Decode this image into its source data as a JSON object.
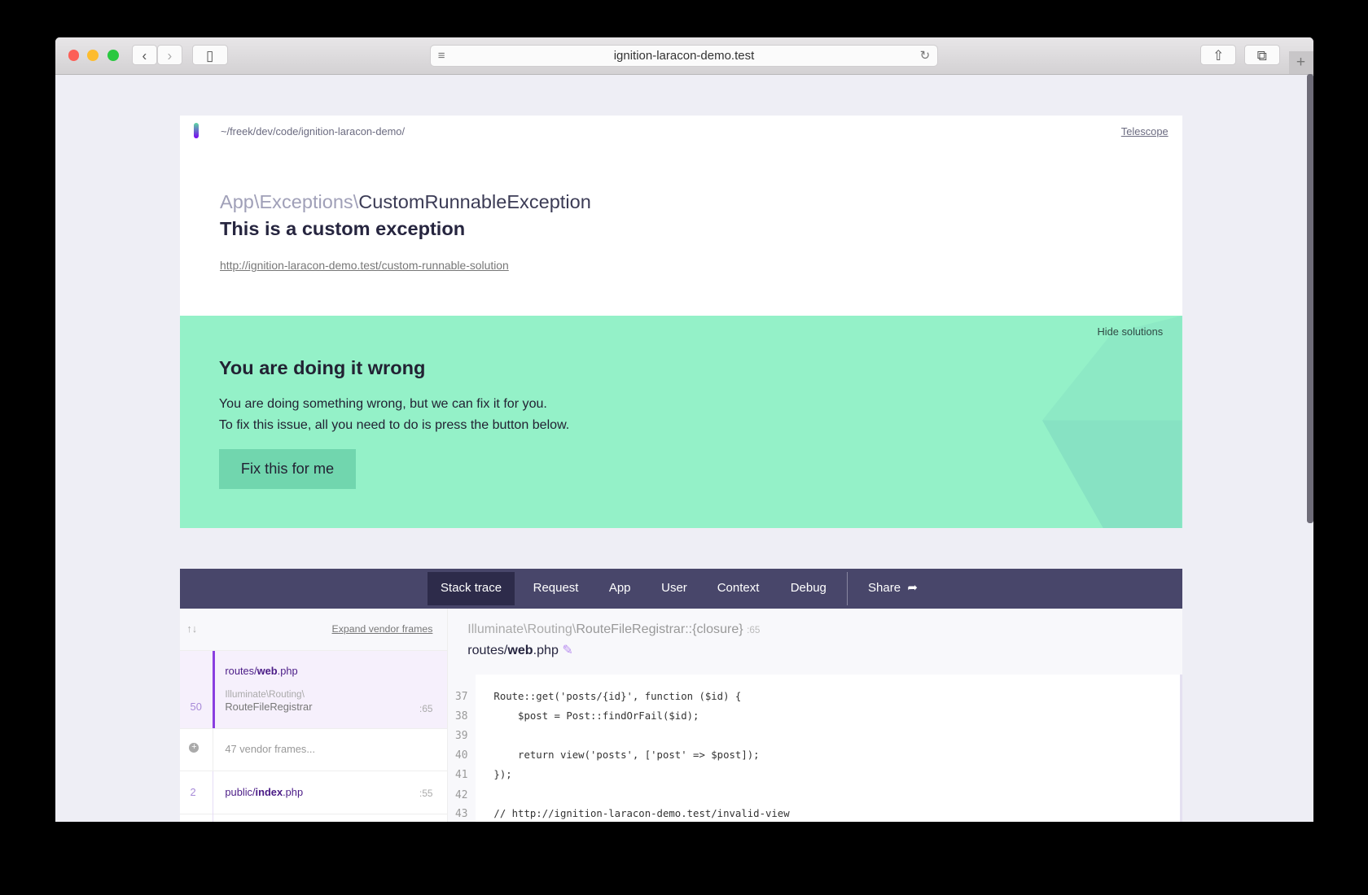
{
  "browser": {
    "url": "ignition-laracon-demo.test"
  },
  "header": {
    "path": "~/freek/dev/code/ignition-laracon-demo/",
    "telescope": "Telescope"
  },
  "exception": {
    "namespace": "App\\Exceptions\\",
    "class": "CustomRunnableException",
    "message": "This is a custom exception",
    "url": "http://ignition-laracon-demo.test/custom-runnable-solution"
  },
  "solution": {
    "hide": "Hide solutions",
    "title": "You are doing it wrong",
    "line1": "You are doing something wrong, but we can fix it for you.",
    "line2": "To fix this issue, all you need to do is press the button below.",
    "button": "Fix this for me"
  },
  "tabs": [
    "Stack trace",
    "Request",
    "App",
    "User",
    "Context",
    "Debug",
    "Share"
  ],
  "stack": {
    "expand": "Expand vendor frames",
    "frames": [
      {
        "num": "50",
        "file_pre": "routes/",
        "file_bold": "web",
        "file_ext": ".php",
        "cls1": "Illuminate\\Routing\\",
        "cls2": "RouteFileRegistrar",
        "line": ":65"
      },
      {
        "vendor": "47 vendor frames..."
      },
      {
        "num": "2",
        "file_pre": "public/",
        "file_bold": "index",
        "file_ext": ".php",
        "line": ":55"
      }
    ]
  },
  "code": {
    "ns": "Illuminate\\Routing\\",
    "cls": "RouteFileRegistrar::{closure}",
    "line": ":65",
    "file_pre": "routes/",
    "file_bold": "web",
    "file_ext": ".php",
    "lines": [
      {
        "n": "37",
        "t": "Route::get('posts/{id}', function ($id) {"
      },
      {
        "n": "38",
        "t": "    $post = Post::findOrFail($id);"
      },
      {
        "n": "39",
        "t": ""
      },
      {
        "n": "40",
        "t": "    return view('posts', ['post' => $post]);"
      },
      {
        "n": "41",
        "t": "});"
      },
      {
        "n": "42",
        "t": ""
      },
      {
        "n": "43",
        "t": "// http://ignition-laracon-demo.test/invalid-view"
      }
    ]
  },
  "colors": {
    "accent": "#7900f5",
    "solution_bg": "#94f1c8",
    "nav_bg": "#48466a"
  }
}
